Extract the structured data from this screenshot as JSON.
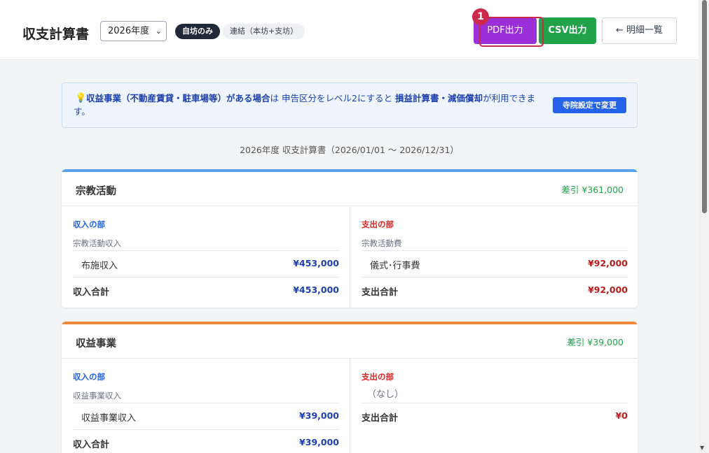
{
  "header": {
    "title": "収支計算書",
    "year_select": "2026年度",
    "seg_active": "自坊のみ",
    "seg_inactive": "連結（本坊+支坊）",
    "pdf_label": "PDF出力",
    "csv_label": "CSV出力",
    "back_label": "← 明細一覧",
    "marker": "1"
  },
  "banner": {
    "icon": "lightbulb-icon",
    "part1": "収益事業（不動産賃貸・駐車場等）がある場合",
    "part2": "は 申告区分をレベル2にすると ",
    "part3": "損益計算書・減価償却",
    "part4": "が利用できます。",
    "button": "寺院設定で変更"
  },
  "period_caption": "2026年度 収支計算書（2026/01/01 〜 2026/12/31）",
  "sections": [
    {
      "title": "宗教活動",
      "diff": "差引 ¥361,000",
      "accent": "#5ba3e8",
      "income": {
        "head": "収入の部",
        "category": "宗教活動収入",
        "items": [
          {
            "label": "布施収入",
            "value": "¥453,000"
          }
        ],
        "total_label": "収入合計",
        "total_value": "¥453,000"
      },
      "expense": {
        "head": "支出の部",
        "category": "宗教活動費",
        "items": [
          {
            "label": "儀式･行事費",
            "value": "¥92,000"
          }
        ],
        "total_label": "支出合計",
        "total_value": "¥92,000"
      }
    },
    {
      "title": "収益事業",
      "diff": "差引 ¥39,000",
      "accent": "#ef8a3c",
      "income": {
        "head": "収入の部",
        "category": "収益事業収入",
        "items": [
          {
            "label": "収益事業収入",
            "value": "¥39,000"
          }
        ],
        "total_label": "収入合計",
        "total_value": "¥39,000"
      },
      "expense": {
        "head": "支出の部",
        "none_label": "（なし）",
        "total_label": "支出合計",
        "total_value": "¥0"
      }
    }
  ]
}
